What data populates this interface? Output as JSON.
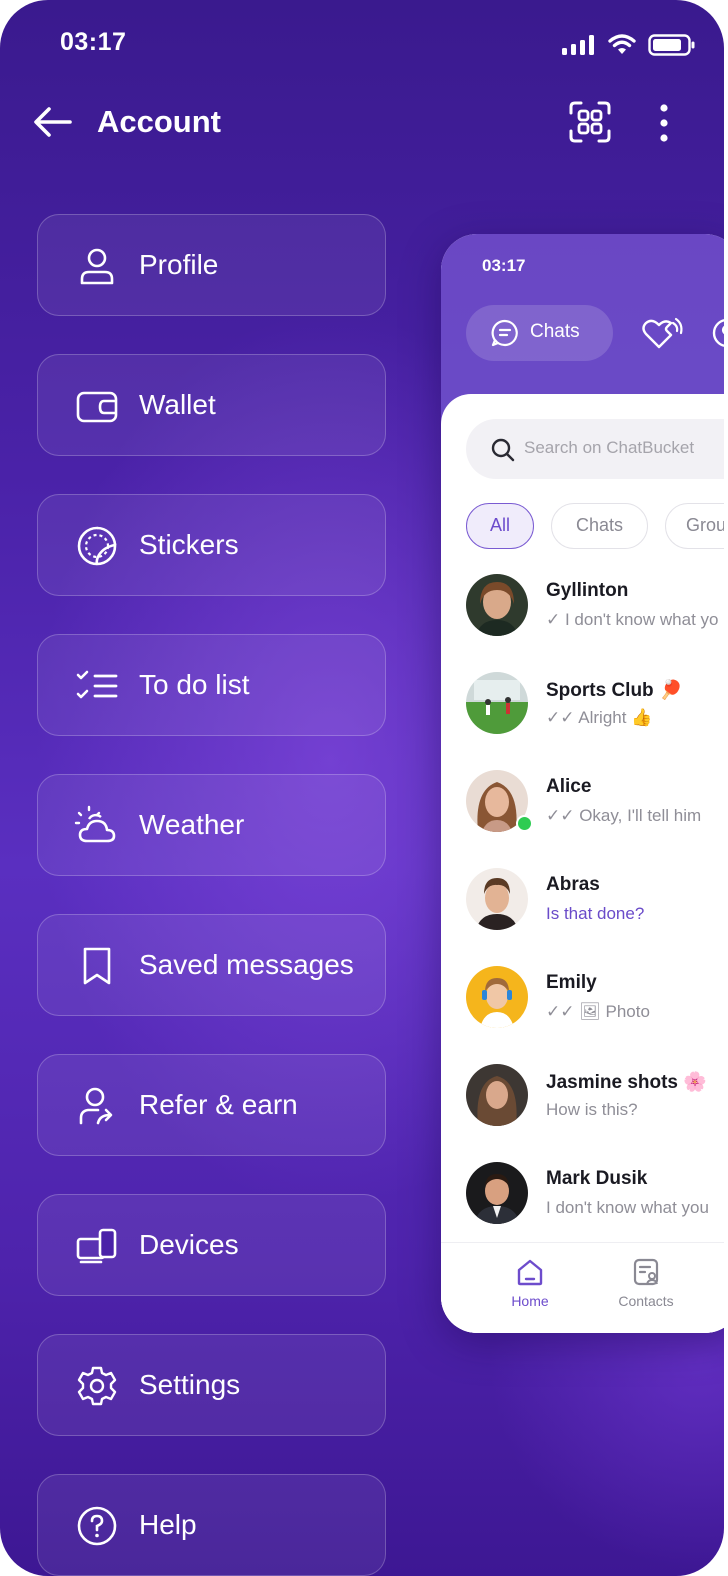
{
  "status_bar": {
    "time": "03:17"
  },
  "header": {
    "title": "Account"
  },
  "menu": [
    {
      "label": "Profile",
      "icon": "user-icon"
    },
    {
      "label": "Wallet",
      "icon": "wallet-icon"
    },
    {
      "label": "Stickers",
      "icon": "sticker-icon"
    },
    {
      "label": "To do list",
      "icon": "checklist-icon"
    },
    {
      "label": "Weather",
      "icon": "weather-icon"
    },
    {
      "label": "Saved messages",
      "icon": "bookmark-icon"
    },
    {
      "label": "Refer & earn",
      "icon": "refer-icon"
    },
    {
      "label": "Devices",
      "icon": "devices-icon"
    },
    {
      "label": "Settings",
      "icon": "gear-icon"
    },
    {
      "label": "Help",
      "icon": "help-icon"
    }
  ],
  "preview": {
    "time": "03:17",
    "tab_label": "Chats",
    "search_placeholder": "Search on ChatBucket",
    "filters": [
      "All",
      "Chats",
      "Grou"
    ],
    "chats": [
      {
        "name": "Gyllinton",
        "message": "✓ I don't know what yo"
      },
      {
        "name": "Sports Club 🏓",
        "message": "✓✓ Alright 👍"
      },
      {
        "name": "Alice",
        "message": "✓✓ Okay, I'll tell him"
      },
      {
        "name": "Abras",
        "message": "Is that done?"
      },
      {
        "name": "Emily",
        "message": "✓✓ 🖼 Photo"
      },
      {
        "name": "Jasmine shots 🌸",
        "message": "How is this?"
      },
      {
        "name": "Mark Dusik",
        "message": "I don't know what you"
      }
    ],
    "nav": {
      "home": "Home",
      "contacts": "Contacts"
    }
  },
  "colors": {
    "accent": "#6d4ccc",
    "background": "#4a22a8",
    "online": "#2ecc52"
  }
}
